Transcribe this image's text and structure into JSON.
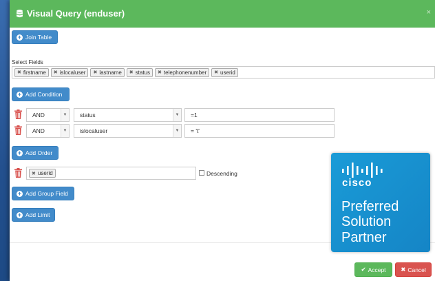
{
  "modal": {
    "title": "Visual Query (enduser)",
    "close": "×"
  },
  "buttons": {
    "join_table": "Join Table",
    "add_condition": "Add Condition",
    "add_order": "Add Order",
    "add_group_field": "Add Group Field",
    "add_limit": "Add Limit",
    "accept": "Accept",
    "cancel": "Cancel"
  },
  "select_fields": {
    "label": "Select Fields",
    "tags": [
      "firstname",
      "islocaluser",
      "lastname",
      "status",
      "telephonenumber",
      "userid"
    ]
  },
  "conditions": [
    {
      "operator": "AND",
      "field": "status",
      "value": "=1"
    },
    {
      "operator": "AND",
      "field": "islocaluser",
      "value": "= 't'"
    }
  ],
  "order": {
    "tags": [
      "userid"
    ],
    "descending_label": "Descending",
    "descending_checked": false
  },
  "badge": {
    "brand": "cisco",
    "line1": "Preferred",
    "line2": "Solution",
    "line3": "Partner"
  },
  "colors": {
    "header_green": "#5cb85c",
    "button_blue": "#428bca",
    "cancel_red": "#d9534f",
    "cisco_blue": "#1a9bd7"
  },
  "icons": [
    "database-icon",
    "plus-circle-icon",
    "trash-icon",
    "check-icon",
    "close-icon",
    "cisco-logo-icon"
  ]
}
